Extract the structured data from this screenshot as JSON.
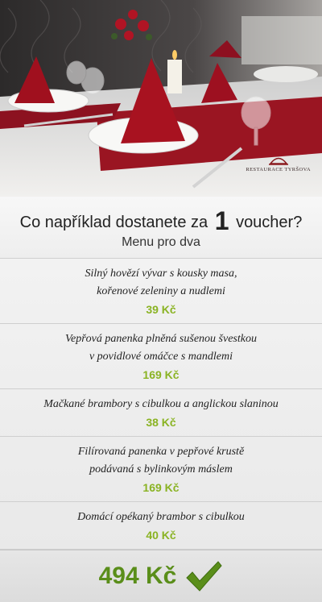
{
  "hero": {
    "logo_text": "RESTAURACE TYRŠOVA"
  },
  "heading": {
    "title_before": "Co například dostanete za",
    "title_number": "1",
    "title_after": "voucher?",
    "subtitle": "Menu pro dva"
  },
  "menu": {
    "items": [
      {
        "lines": [
          "Silný hovězí vývar s kousky masa,",
          "kořenové zeleniny a nudlemi"
        ],
        "price": "39 Kč"
      },
      {
        "lines": [
          "Vepřová panenka plněná sušenou švestkou",
          "v povidlové omáčce s mandlemi"
        ],
        "price": "169 Kč"
      },
      {
        "lines": [
          "Mačkané brambory s cibulkou a anglickou slaninou"
        ],
        "price": "38 Kč"
      },
      {
        "lines": [
          "Filírovaná panenka v pepřové krustě",
          "podávaná s bylinkovým máslem"
        ],
        "price": "169 Kč"
      },
      {
        "lines": [
          "Domácí opékaný brambor s cibulkou"
        ],
        "price": "40 Kč"
      }
    ]
  },
  "total": {
    "price": "494 Kč",
    "icon": "checkmark-icon",
    "accent_color": "#5a8e1a",
    "price_color": "#8ab323"
  }
}
